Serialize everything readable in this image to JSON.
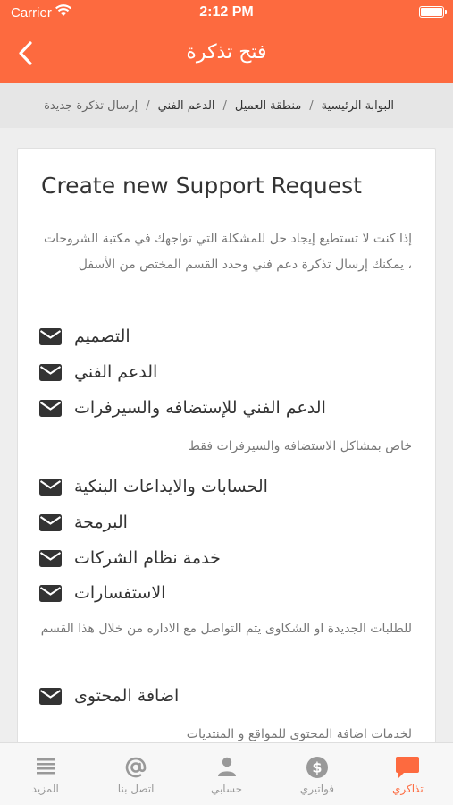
{
  "status": {
    "carrier": "Carrier",
    "time": "2:12 PM"
  },
  "nav": {
    "title": "فتح تذكرة"
  },
  "breadcrumb": [
    "البوابة الرئيسية",
    "منطقة العميل",
    "الدعم الفني",
    "إرسال تذكرة جديدة"
  ],
  "card": {
    "title": "Create new Support Request",
    "intro": "إذا كنت لا تستطيع إيجاد حل للمشكلة التي تواجهك في مكتبة الشروحات ، يمكنك إرسال تذكرة دعم فني وحدد القسم المختص من الأسفل"
  },
  "options": [
    {
      "label": "التصميم",
      "icon": "envelope-icon"
    },
    {
      "label": "الدعم الفني",
      "icon": "envelope-icon"
    },
    {
      "label": "الدعم الفني للإستضافه والسيرفرات",
      "icon": "envelope-icon"
    },
    {
      "label": "الحسابات والايداعات البنكية",
      "icon": "envelope-icon"
    },
    {
      "label": "البرمجة",
      "icon": "envelope-icon"
    },
    {
      "label": "خدمة نظام الشركات",
      "icon": "envelope-icon"
    },
    {
      "label": "الاستفسارات",
      "icon": "envelope-icon"
    },
    {
      "label": "اضافة المحتوى",
      "icon": "envelope-icon"
    }
  ],
  "descriptions": {
    "hosting": "خاص بمشاكل الاستضافه والسيرفرات فقط",
    "inquiries": "للطلبات الجديدة او الشكاوى يتم التواصل مع الاداره من خلال هذا القسم",
    "content": "لخدمات اضافة المحتوى للمواقع و المنتديات"
  },
  "tabs": [
    {
      "label": "تذاكري",
      "icon": "chat-bubble-icon",
      "active": true
    },
    {
      "label": "فواتيري",
      "icon": "dollar-icon",
      "active": false
    },
    {
      "label": "حسابي",
      "icon": "user-icon",
      "active": false
    },
    {
      "label": "اتصل بنا",
      "icon": "at-sign-icon",
      "active": false
    },
    {
      "label": "المزيد",
      "icon": "menu-lines-icon",
      "active": false
    }
  ],
  "colors": {
    "accent": "#fd6a3f",
    "text": "#333333",
    "muted": "#777777"
  }
}
